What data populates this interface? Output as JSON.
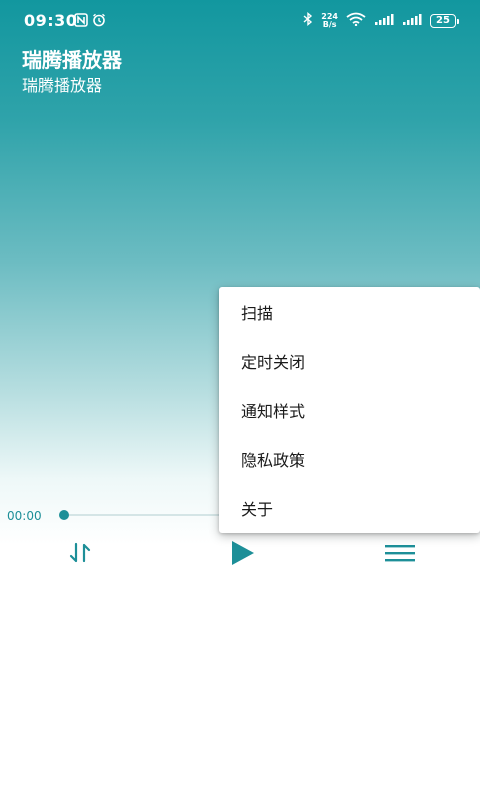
{
  "status_bar": {
    "time": "09:30",
    "net_speed_value": "224",
    "net_speed_unit": "B/s",
    "battery": "25"
  },
  "header": {
    "title": "瑞腾播放器",
    "subtitle": "瑞腾播放器"
  },
  "player": {
    "elapsed": "00:00",
    "progress": 0
  },
  "menu": {
    "items": [
      {
        "label": "扫描"
      },
      {
        "label": "定时关闭"
      },
      {
        "label": "通知样式"
      },
      {
        "label": "隐私政策"
      },
      {
        "label": "关于"
      }
    ]
  },
  "colors": {
    "accent": "#1d8f98",
    "header_top": "#12979f"
  },
  "icons": {
    "sort": "sort-icon",
    "play": "play-icon",
    "menu": "playlist-menu-icon"
  }
}
